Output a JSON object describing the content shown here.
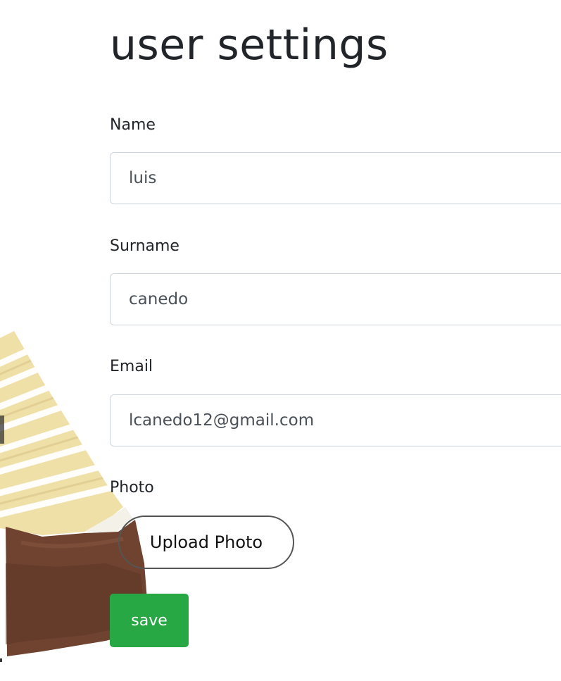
{
  "page": {
    "title": "user settings"
  },
  "form": {
    "name": {
      "label": "Name",
      "value": "luis"
    },
    "surname": {
      "label": "Surname",
      "value": "canedo"
    },
    "email": {
      "label": "Email",
      "value": "lcanedo12@gmail.com"
    },
    "photo": {
      "label": "Photo",
      "upload_label": "Upload Photo"
    },
    "save_label": "save"
  },
  "colors": {
    "save_button": "#28a745",
    "input_border": "#ced4da",
    "text": "#212529"
  }
}
